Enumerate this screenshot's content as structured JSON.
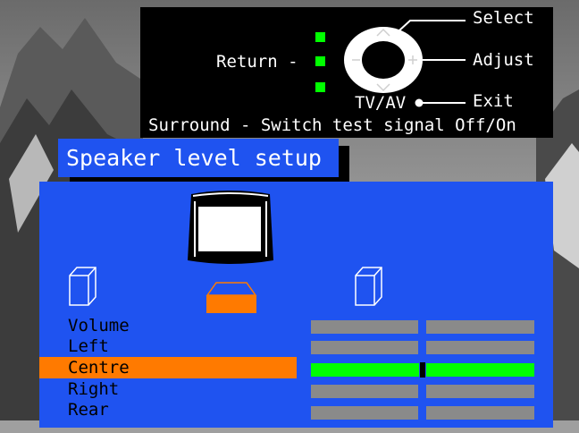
{
  "help": {
    "return_label": "Return -",
    "select_label": "Select",
    "adjust_label": "Adjust",
    "tvav_label": "TV/AV",
    "exit_label": "Exit",
    "surround_hint": "Surround - Switch test signal Off/On"
  },
  "title": "Speaker level setup",
  "menu": {
    "items": [
      {
        "label": "Volume",
        "level": 0.5,
        "selected": false
      },
      {
        "label": "Left",
        "level": 0.5,
        "selected": false
      },
      {
        "label": "Centre",
        "level": 0.5,
        "selected": true
      },
      {
        "label": "Right",
        "level": 0.5,
        "selected": false
      },
      {
        "label": "Rear",
        "level": 0.5,
        "selected": false
      }
    ]
  },
  "colors": {
    "panel_blue": "#1f53f0",
    "selection_orange": "#ff7a00",
    "active_bar_green": "#00ff00",
    "inactive_bar_grey": "#8a8a8a"
  },
  "icons": {
    "tv": "tv-icon",
    "left_speaker": "left-speaker-icon",
    "centre_speaker": "centre-speaker-icon",
    "right_speaker": "right-speaker-icon",
    "remote_pad": "remote-dpad-icon"
  }
}
